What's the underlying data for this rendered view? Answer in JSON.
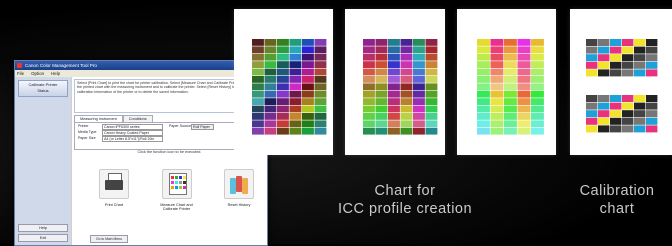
{
  "window": {
    "title": "Canon Color Management Tool Pro",
    "menu": [
      "File",
      "Option",
      "Help"
    ],
    "sidebar": {
      "items": [
        "Calibrate Printer",
        "Status"
      ],
      "help_label": "Help",
      "exit_label": "Exit"
    },
    "description": "Select [Print Chart] to print the chart for printer calibration. Select [Measure Chart and Calibrate Printer] to measure the printed chart with the measuring instrument and to calibrate the printer. Select [Reset History] to initialize the calibration information of the printer or to delete the saved information.",
    "tabs": [
      "Measuring Instrument",
      "Conditions"
    ],
    "fields": {
      "printer_label": "Printer",
      "printer_value": "Canon iPF6300 series",
      "paper_source_label": "Paper Source",
      "paper_source_value": "Roll Paper",
      "media_type_label": "Media Type",
      "media_type_value": "Canon Heavy Coated Paper",
      "paper_size_label": "Paper Size",
      "paper_size_value": "A4 (or Letter 8.5\"x11\")/Roll 10in"
    },
    "hint": "Click the function icon to be executed.",
    "actions": [
      {
        "label": "Print Chart",
        "icon": "printer-icon"
      },
      {
        "label": "Measure Chart and Calibrate Printer",
        "icon": "measure-chart-icon"
      },
      {
        "label": "Reset History",
        "icon": "reset-bottles-icon"
      }
    ],
    "goto_label": "Go to Main Menu"
  },
  "captions": {
    "icc": "Chart for\nICC profile creation",
    "calibration": "Calibration\nchart"
  },
  "colors": {
    "background": "#000000",
    "window_title": "#1c3f86",
    "caption_text": "#c9c9c9"
  }
}
